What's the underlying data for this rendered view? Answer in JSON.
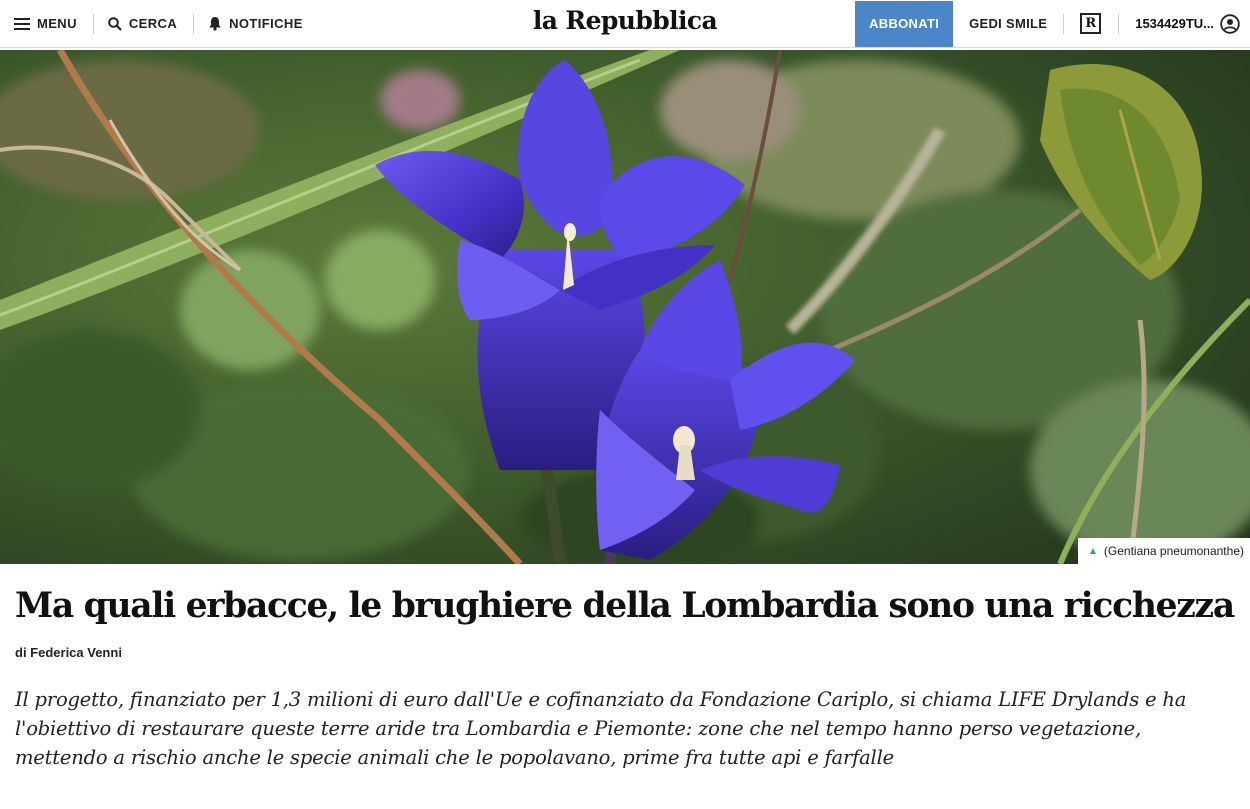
{
  "header": {
    "menu_label": "MENU",
    "search_label": "CERCA",
    "notifications_label": "NOTIFICHE",
    "logo_text": "la Repubblica",
    "subscribe_label": "ABBONATI",
    "gedi_label": "GEDI SMILE",
    "r_badge": "R",
    "user_label": "1534429TU..."
  },
  "hero": {
    "caption": "(Gentiana pneumonanthe)",
    "caption_icon": "triangle-up-icon"
  },
  "article": {
    "title": "Ma quali erbacce, le brughiere della Lombardia sono una ricchezza",
    "byline": "di Federica Venni",
    "summary": "Il progetto, finanziato per 1,3 milioni di euro dall'Ue e cofinanziato da Fondazione Cariplo, si chiama LIFE Drylands e ha l'obiettivo di restaurare queste terre aride tra Lombardia e Piemonte: zone che nel tempo hanno perso vegetazione, mettendo a rischio anche le specie animali che le popolavano, prime fra tutte api e farfalle"
  },
  "colors": {
    "accent": "#4a86c8",
    "flower": "#4b39d6"
  }
}
